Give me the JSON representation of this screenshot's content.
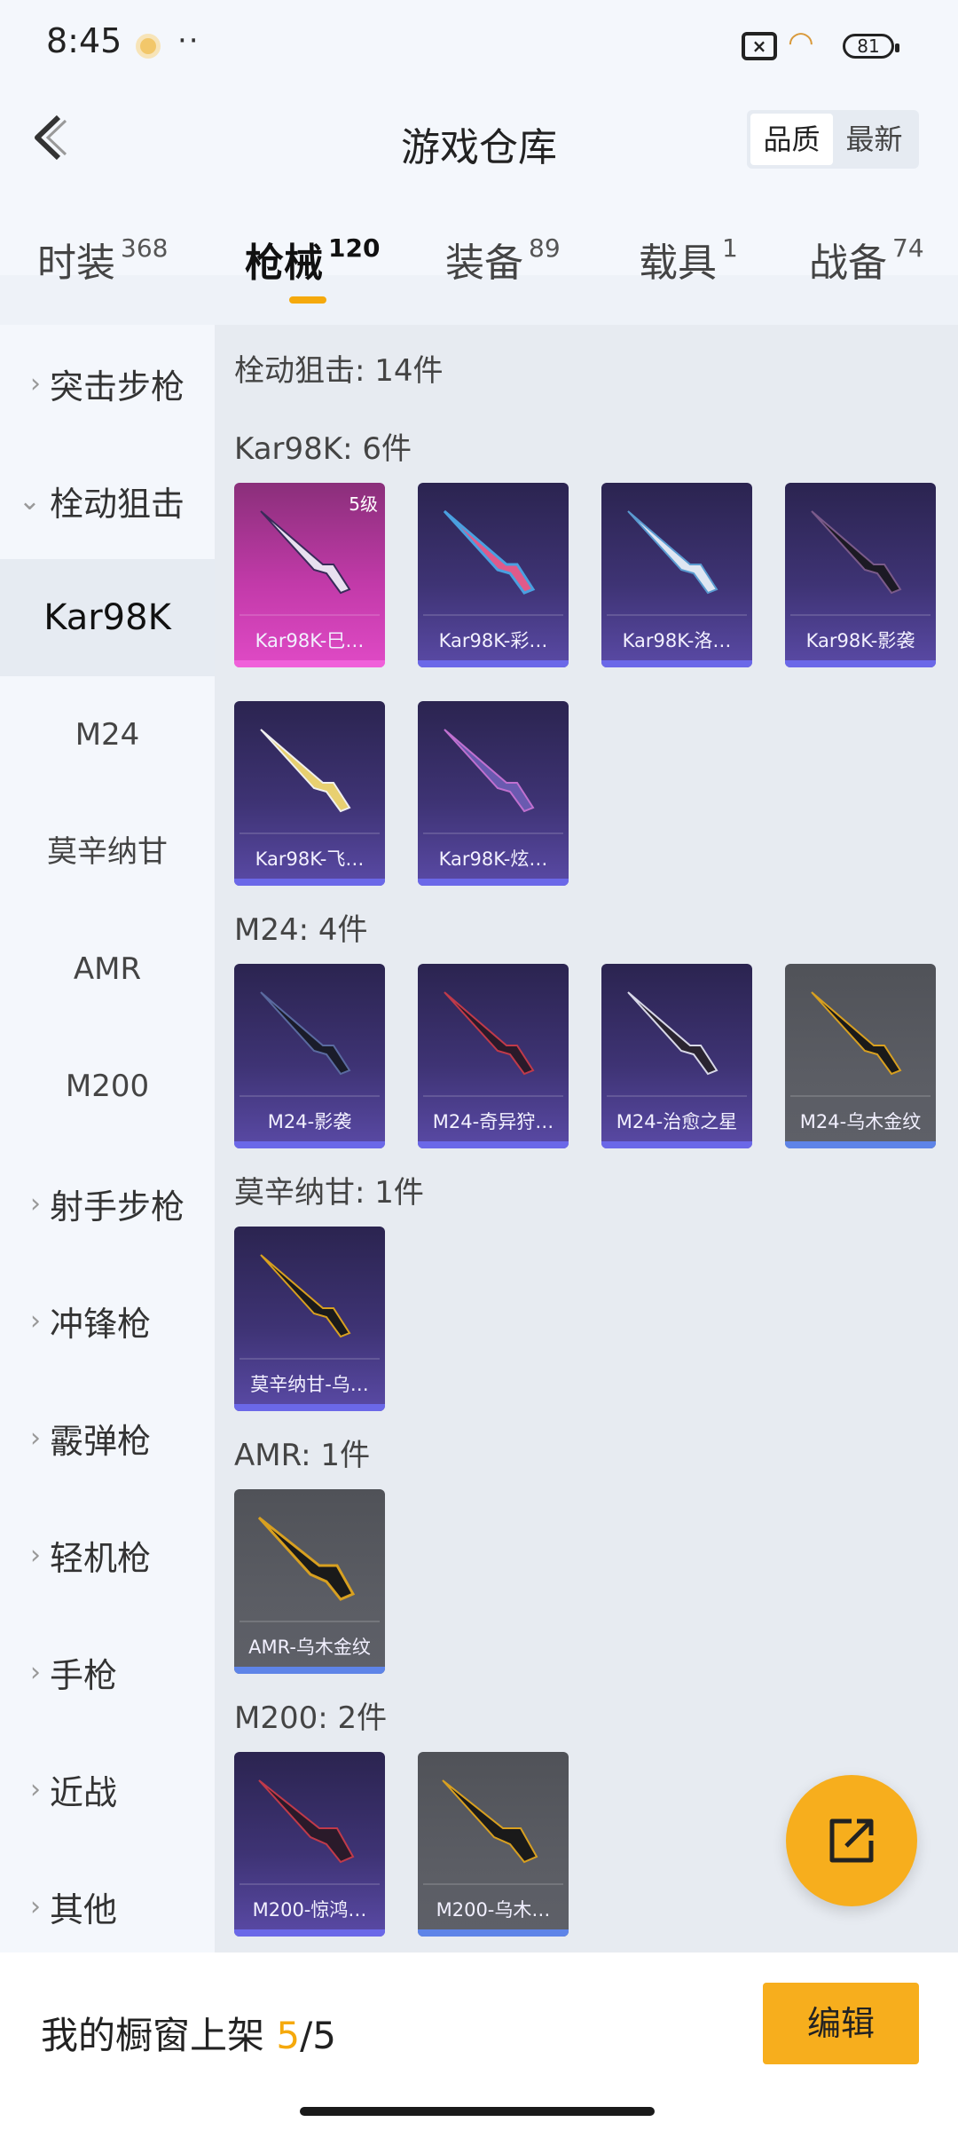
{
  "status_bar": {
    "time": "8:45",
    "dots": "··",
    "battery": "81"
  },
  "header": {
    "title": "游戏仓库",
    "sort_options": [
      "品质",
      "最新"
    ]
  },
  "tabs": [
    {
      "label": "时装",
      "count": "368"
    },
    {
      "label": "枪械",
      "count": "120"
    },
    {
      "label": "装备",
      "count": "89"
    },
    {
      "label": "载具",
      "count": "1"
    },
    {
      "label": "战备",
      "count": "74"
    }
  ],
  "sidebar": {
    "categories": [
      "突击步枪",
      "栓动狙击",
      "射手步枪",
      "冲锋枪",
      "霰弹枪",
      "轻机枪",
      "手枪",
      "近战",
      "其他"
    ],
    "subitems": [
      "Kar98K",
      "M24",
      "莫辛纳甘",
      "AMR",
      "M200"
    ]
  },
  "content": {
    "total_title": "栓动狙击: 14件",
    "groups": [
      {
        "title": "Kar98K: 6件",
        "items": [
          {
            "name": "Kar98K-巳…",
            "level": "5级",
            "quality": "legend"
          },
          {
            "name": "Kar98K-彩…",
            "quality": "epic"
          },
          {
            "name": "Kar98K-洛…",
            "quality": "epic"
          },
          {
            "name": "Kar98K-影袭",
            "quality": "epic"
          },
          {
            "name": "Kar98K-飞…",
            "quality": "epic"
          },
          {
            "name": "Kar98K-炫…",
            "quality": "epic"
          }
        ]
      },
      {
        "title": "M24: 4件",
        "items": [
          {
            "name": "M24-影袭",
            "quality": "epic"
          },
          {
            "name": "M24-奇异狩…",
            "quality": "epic"
          },
          {
            "name": "M24-治愈之星",
            "quality": "epic"
          },
          {
            "name": "M24-乌木金纹",
            "quality": "rare"
          }
        ]
      },
      {
        "title": "莫辛纳甘: 1件",
        "items": [
          {
            "name": "莫辛纳甘-乌…",
            "quality": "epic"
          }
        ]
      },
      {
        "title": "AMR: 1件",
        "items": [
          {
            "name": "AMR-乌木金纹",
            "quality": "rare"
          }
        ]
      },
      {
        "title": "M200: 2件",
        "items": [
          {
            "name": "M200-惊鸿…",
            "quality": "epic"
          },
          {
            "name": "M200-乌木…",
            "quality": "rare"
          }
        ]
      }
    ]
  },
  "bottom_bar": {
    "label": "我的橱窗上架",
    "count_current": "5",
    "count_total": "/5",
    "edit_label": "编辑"
  },
  "colors": {
    "accent": "#f7ae1d",
    "epic": "#6b68e8",
    "legend": "#f060da"
  }
}
